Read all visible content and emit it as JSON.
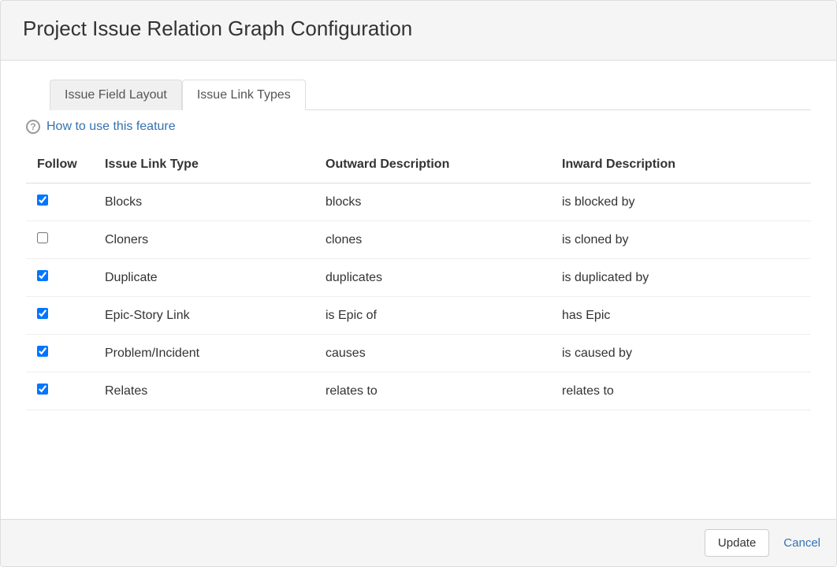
{
  "dialog": {
    "title": "Project Issue Relation Graph Configuration"
  },
  "tabs": {
    "inactive_label": "Issue Field Layout",
    "active_label": "Issue Link Types"
  },
  "help": {
    "link_text": "How to use this feature"
  },
  "table": {
    "headers": {
      "follow": "Follow",
      "link_type": "Issue Link Type",
      "outward": "Outward Description",
      "inward": "Inward Description"
    },
    "rows": [
      {
        "follow": true,
        "name": "Blocks",
        "outward": "blocks",
        "inward": "is blocked by"
      },
      {
        "follow": false,
        "name": "Cloners",
        "outward": "clones",
        "inward": "is cloned by"
      },
      {
        "follow": true,
        "name": "Duplicate",
        "outward": "duplicates",
        "inward": "is duplicated by"
      },
      {
        "follow": true,
        "name": "Epic-Story Link",
        "outward": "is Epic of",
        "inward": "has Epic"
      },
      {
        "follow": true,
        "name": "Problem/Incident",
        "outward": "causes",
        "inward": "is caused by"
      },
      {
        "follow": true,
        "name": "Relates",
        "outward": "relates to",
        "inward": "relates to"
      }
    ]
  },
  "footer": {
    "update_label": "Update",
    "cancel_label": "Cancel"
  }
}
